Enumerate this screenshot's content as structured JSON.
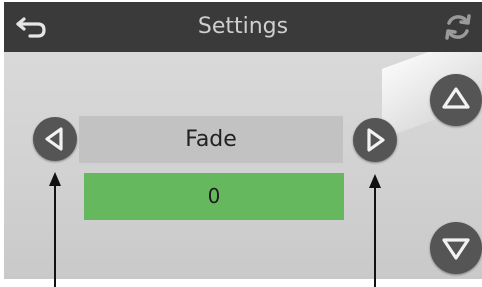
{
  "header": {
    "title": "Settings"
  },
  "setting": {
    "label": "Fade",
    "value": "0"
  },
  "colors": {
    "topbar": "#3a3a3a",
    "value_bg": "#66b85f",
    "button": "#555555"
  },
  "icons": {
    "back": "back-arrow-icon",
    "refresh": "refresh-icon",
    "prev": "triangle-left-icon",
    "next": "triangle-right-icon",
    "up": "triangle-up-icon",
    "down": "triangle-down-icon"
  }
}
